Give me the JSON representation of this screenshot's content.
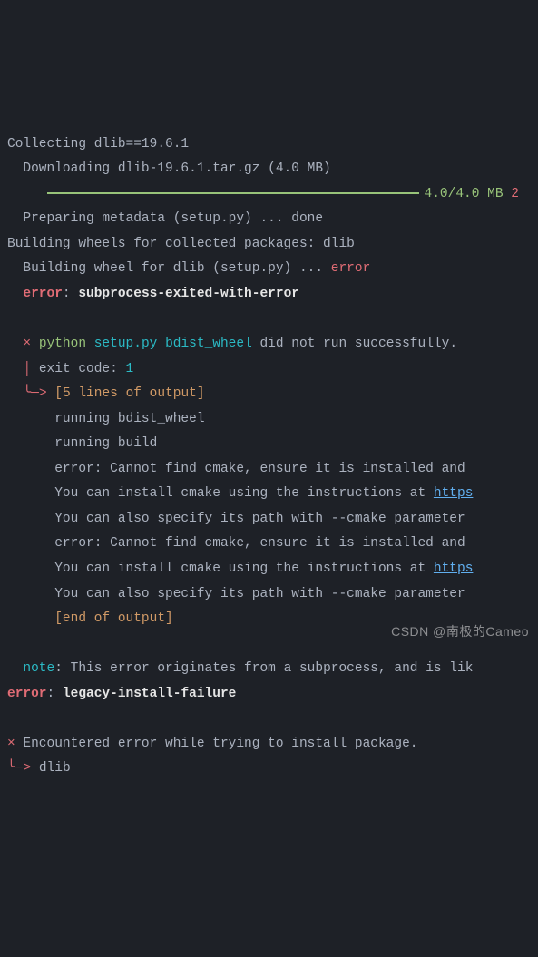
{
  "lines": {
    "collecting": "Collecting dlib==19.6.1",
    "downloading": "  Downloading dlib-19.6.1.tar.gz (4.0 MB)",
    "progress_text": "4.0/4.0 MB",
    "progress_trail": "2",
    "preparing": "  Preparing metadata (setup.py) ... done",
    "building_wheels": "Building wheels for collected packages: dlib",
    "building_wheel": "  Building wheel for dlib (setup.py) ... ",
    "building_wheel_error": "error",
    "error_label": "  error",
    "error_sep": ": ",
    "error_msg": "subprocess-exited-with-error",
    "cross": "  × ",
    "py_cmd_python": "python ",
    "py_cmd_setup": "setup.py ",
    "py_cmd_bdist": "bdist_wheel",
    "didnot": " did not run successfully.",
    "pipe": "  │ ",
    "exit_code_label": "exit code: ",
    "exit_code_val": "1",
    "elbow": "  ╰─> ",
    "output_header": "[5 lines of output]",
    "out1": "      running bdist_wheel",
    "out2": "      running build",
    "out3": "      error: Cannot find cmake, ensure it is installed and",
    "out4a": "      You can install cmake using the instructions at ",
    "out4b": "https",
    "out5": "      You can also specify its path with --cmake parameter",
    "out6": "      error: Cannot find cmake, ensure it is installed and",
    "out7a": "      You can install cmake using the instructions at ",
    "out7b": "https",
    "out8": "      You can also specify its path with --cmake parameter",
    "end_output": "      [end of output]",
    "note_label": "  note",
    "note_sep": ": ",
    "note_text": "This error originates from a subprocess, and is lik",
    "error2_label": "error",
    "error2_sep": ": ",
    "error2_msg": "legacy-install-failure",
    "cross2": "× ",
    "encountered": "Encountered error while trying to install package.",
    "elbow2": "╰─> ",
    "pkg": "dlib"
  },
  "watermark": "CSDN @南极的Cameo"
}
